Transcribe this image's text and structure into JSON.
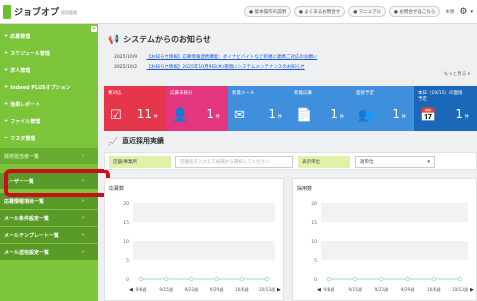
{
  "header": {
    "logo_text": "ジョブオプ",
    "logo_sub": "採用管理",
    "pills": [
      "● 基本操作の説明",
      "● よくあるお問合せ",
      "● マニュアル",
      "● お問合せはこちら"
    ],
    "user": "木原",
    "gear_icon": "gear-icon"
  },
  "sidebar": {
    "collapse_label": "«",
    "items": [
      {
        "label": "応募管理",
        "prefix": "+"
      },
      {
        "label": "スケジュール管理",
        "prefix": "+"
      },
      {
        "label": "求人管理",
        "prefix": "+"
      },
      {
        "label": "Indeed PLUSオプション",
        "prefix": "+"
      },
      {
        "label": "効果レポート",
        "prefix": "+"
      },
      {
        "label": "ファイル管理",
        "prefix": "+"
      },
      {
        "label": "マスタ管理",
        "prefix": "−"
      },
      {
        "label": "採用担当者一覧",
        "prefix": ""
      },
      {
        "label": "ユーザー一覧",
        "prefix": ""
      },
      {
        "label": "応募情報項目一覧",
        "prefix": ""
      },
      {
        "label": "メール条件設定一覧",
        "prefix": ""
      },
      {
        "label": "メールテンプレート一覧",
        "prefix": ""
      },
      {
        "label": "メール送信設定一覧",
        "prefix": ""
      }
    ],
    "arrow": "›"
  },
  "notices": {
    "title": "システムからのお知らせ",
    "icon": "megaphone-icon",
    "rows": [
      {
        "date": "2025/10/9",
        "text": "【お知らせ情報】応募情報連携機能：ダイナビバイトなど新規に連携ご対応のお願い"
      },
      {
        "date": "2025/10/2",
        "text": "【お知らせ情報】2025年10月9日(木)夜間にシステムメンテナンスのお知らせ"
      }
    ],
    "more": "もっと見る ▾"
  },
  "cards": [
    {
      "label": "要対応",
      "label2": "",
      "icon": "☑",
      "value": "11",
      "unit": "件",
      "color": "#e5354a"
    },
    {
      "label": "応募未振分",
      "label2": "",
      "icon": "👤",
      "value": "1",
      "unit": "件",
      "color": "#e2377f"
    },
    {
      "label": "新着メール",
      "label2": "",
      "icon": "✉",
      "value": "1",
      "unit": "件",
      "color": "#3f8fdc"
    },
    {
      "label": "新着応募",
      "label2": "",
      "icon": "📄",
      "value": "1",
      "unit": "件",
      "color": "#3f8fdc"
    },
    {
      "label": "面接予定",
      "label2": "",
      "icon": "👥",
      "value": "1",
      "unit": "件",
      "color": "#3f8fdc"
    },
    {
      "label": "本日（10/15）の面接",
      "label2": "予定",
      "icon": "📅",
      "value": "1",
      "unit": "件",
      "color": "#1b67b8"
    }
  ],
  "performance": {
    "title": "直近採用実績",
    "icon": "chart-icon",
    "filter": {
      "store_label": "店舗/事業所",
      "store_placeholder": "店舗名を入力して候補から選択してください",
      "display_label": "表示単位",
      "unit_value": "週単位",
      "select_arrow": "▾"
    }
  },
  "chart_data": [
    {
      "type": "line",
      "title": "応募数",
      "categories": [
        "9/8週",
        "9/15週",
        "9/22週",
        "9/29週",
        "10/6週",
        "10/13週"
      ],
      "series": [
        {
          "values": [
            0,
            0,
            0,
            0,
            0,
            0
          ]
        }
      ],
      "ylim": [
        0,
        20
      ],
      "yticks": [
        0,
        5,
        10,
        15,
        20
      ],
      "color": "#9fd3e0",
      "grid": true
    },
    {
      "type": "line",
      "title": "採用数",
      "categories": [
        "9/8週",
        "9/15週",
        "9/22週",
        "9/29週",
        "10/6週",
        "10/13週"
      ],
      "series": [
        {
          "values": [
            0,
            0,
            0,
            0,
            0,
            0
          ]
        }
      ],
      "ylim": [
        0,
        20
      ],
      "yticks": [
        0,
        5,
        10,
        15,
        20
      ],
      "color": "#9fd3e0",
      "grid": true
    }
  ]
}
